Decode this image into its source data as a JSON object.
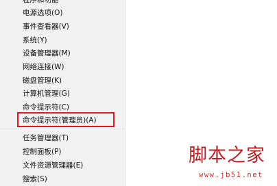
{
  "menu": {
    "items": [
      {
        "label": "程序和功能"
      },
      {
        "label": "电源选项(O)"
      },
      {
        "label": "事件查看器(V)"
      },
      {
        "label": "系统(Y)"
      },
      {
        "label": "设备管理器(M)"
      },
      {
        "label": "网络连接(W)"
      },
      {
        "label": "磁盘管理(K)"
      },
      {
        "label": "计算机管理(G)"
      },
      {
        "label": "命令提示符(C)"
      },
      {
        "label": "命令提示符(管理员)(A)"
      },
      {
        "label": "任务管理器(T)"
      },
      {
        "label": "控制面板(P)"
      },
      {
        "label": "文件资源管理器(E)"
      },
      {
        "label": "搜索(S)"
      }
    ],
    "highlighted_item": "命令提示符(管理员)(A)",
    "highlight_color": "#e0191f"
  },
  "watermark": {
    "title": "脚本之家",
    "url": "www.jb51.net",
    "color": "#bf1d22"
  }
}
